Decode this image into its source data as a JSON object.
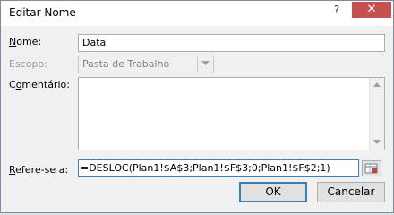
{
  "window": {
    "title": "Editar Nome",
    "help_label": "?",
    "close_label": "✕"
  },
  "form": {
    "name": {
      "label_accel": "N",
      "label_rest": "ome:",
      "value": "Data"
    },
    "scope": {
      "label": "Escopo:",
      "value": "Pasta de Trabalho"
    },
    "comment": {
      "label_pre": "C",
      "label_accel": "o",
      "label_rest": "mentário:",
      "value": ""
    },
    "refers_to": {
      "label_accel": "R",
      "label_rest": "efere-se a:",
      "value": "=DESLOC(Plan1!$A$3;Plan1!$F$3;0;Plan1!$F$2;1)"
    }
  },
  "buttons": {
    "ok": "OK",
    "cancel": "Cancelar"
  },
  "icons": {
    "dropdown": "chevron-down-icon",
    "collapse": "range-collapse-icon",
    "scroll_up": "arrow-up-icon",
    "scroll_down": "arrow-down-icon"
  },
  "colors": {
    "close_button": "#c75050",
    "focus_border": "#3c7fb1"
  }
}
